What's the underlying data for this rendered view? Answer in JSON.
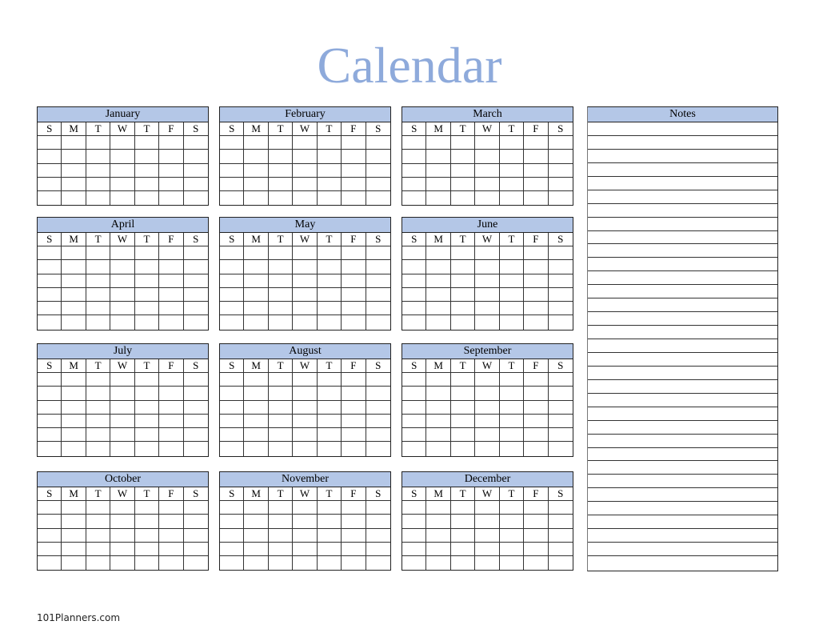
{
  "title": "Calendar",
  "weekdays": [
    "S",
    "M",
    "T",
    "W",
    "T",
    "F",
    "S"
  ],
  "months": [
    {
      "name": "January",
      "weeks": 5
    },
    {
      "name": "February",
      "weeks": 5
    },
    {
      "name": "March",
      "weeks": 5
    },
    {
      "name": "April",
      "weeks": 6
    },
    {
      "name": "May",
      "weeks": 6
    },
    {
      "name": "June",
      "weeks": 6
    },
    {
      "name": "July",
      "weeks": 6
    },
    {
      "name": "August",
      "weeks": 6
    },
    {
      "name": "September",
      "weeks": 6
    },
    {
      "name": "October",
      "weeks": 5
    },
    {
      "name": "November",
      "weeks": 5
    },
    {
      "name": "December",
      "weeks": 5
    }
  ],
  "notes": {
    "label": "Notes",
    "lines": 33
  },
  "footer": "101Planners.com",
  "colors": {
    "title": "#8eaadb",
    "header_fill": "#b4c7e7"
  }
}
